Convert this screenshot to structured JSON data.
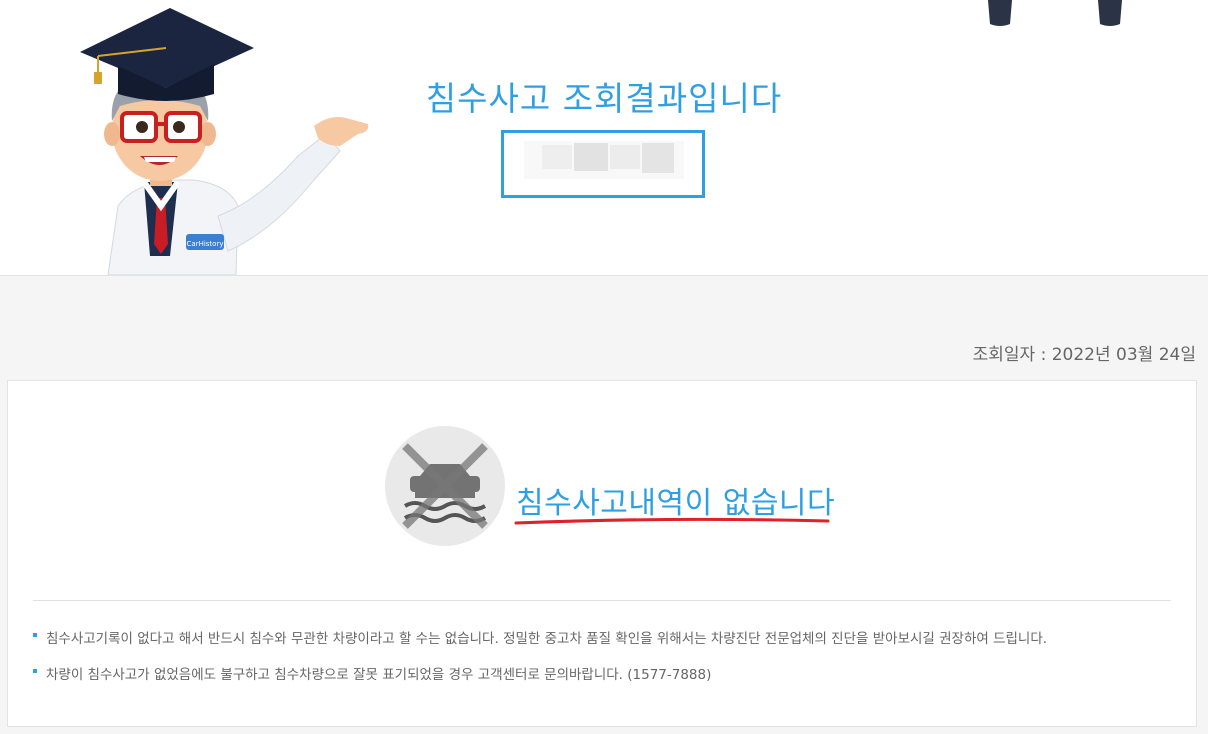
{
  "header": {
    "title": "침수사고 조회결과입니다",
    "badge_text": "CarHistory"
  },
  "result": {
    "date_label": "조회일자 : 2022년 03월 24일",
    "no_record_text": "침수사고내역이 없습니다",
    "notes": [
      "침수사고기록이 없다고 해서 반드시 침수와 무관한 차량이라고 할 수는 없습니다. 정밀한 중고차 품질 확인을 위해서는 차량진단 전문업체의 진단을 받아보시길 권장하여 드립니다.",
      "차량이 침수사고가 없었음에도 불구하고 침수차량으로 잘못 표기되었을 경우 고객센터로 문의바랍니다. (1577-7888)"
    ]
  },
  "colors": {
    "accent": "#2f9fe3",
    "underline": "#e0202a",
    "background": "#f5f5f5"
  },
  "icons": [
    "professor-mascot",
    "flooded-car-icon",
    "cross-icon",
    "legs-illustration"
  ]
}
